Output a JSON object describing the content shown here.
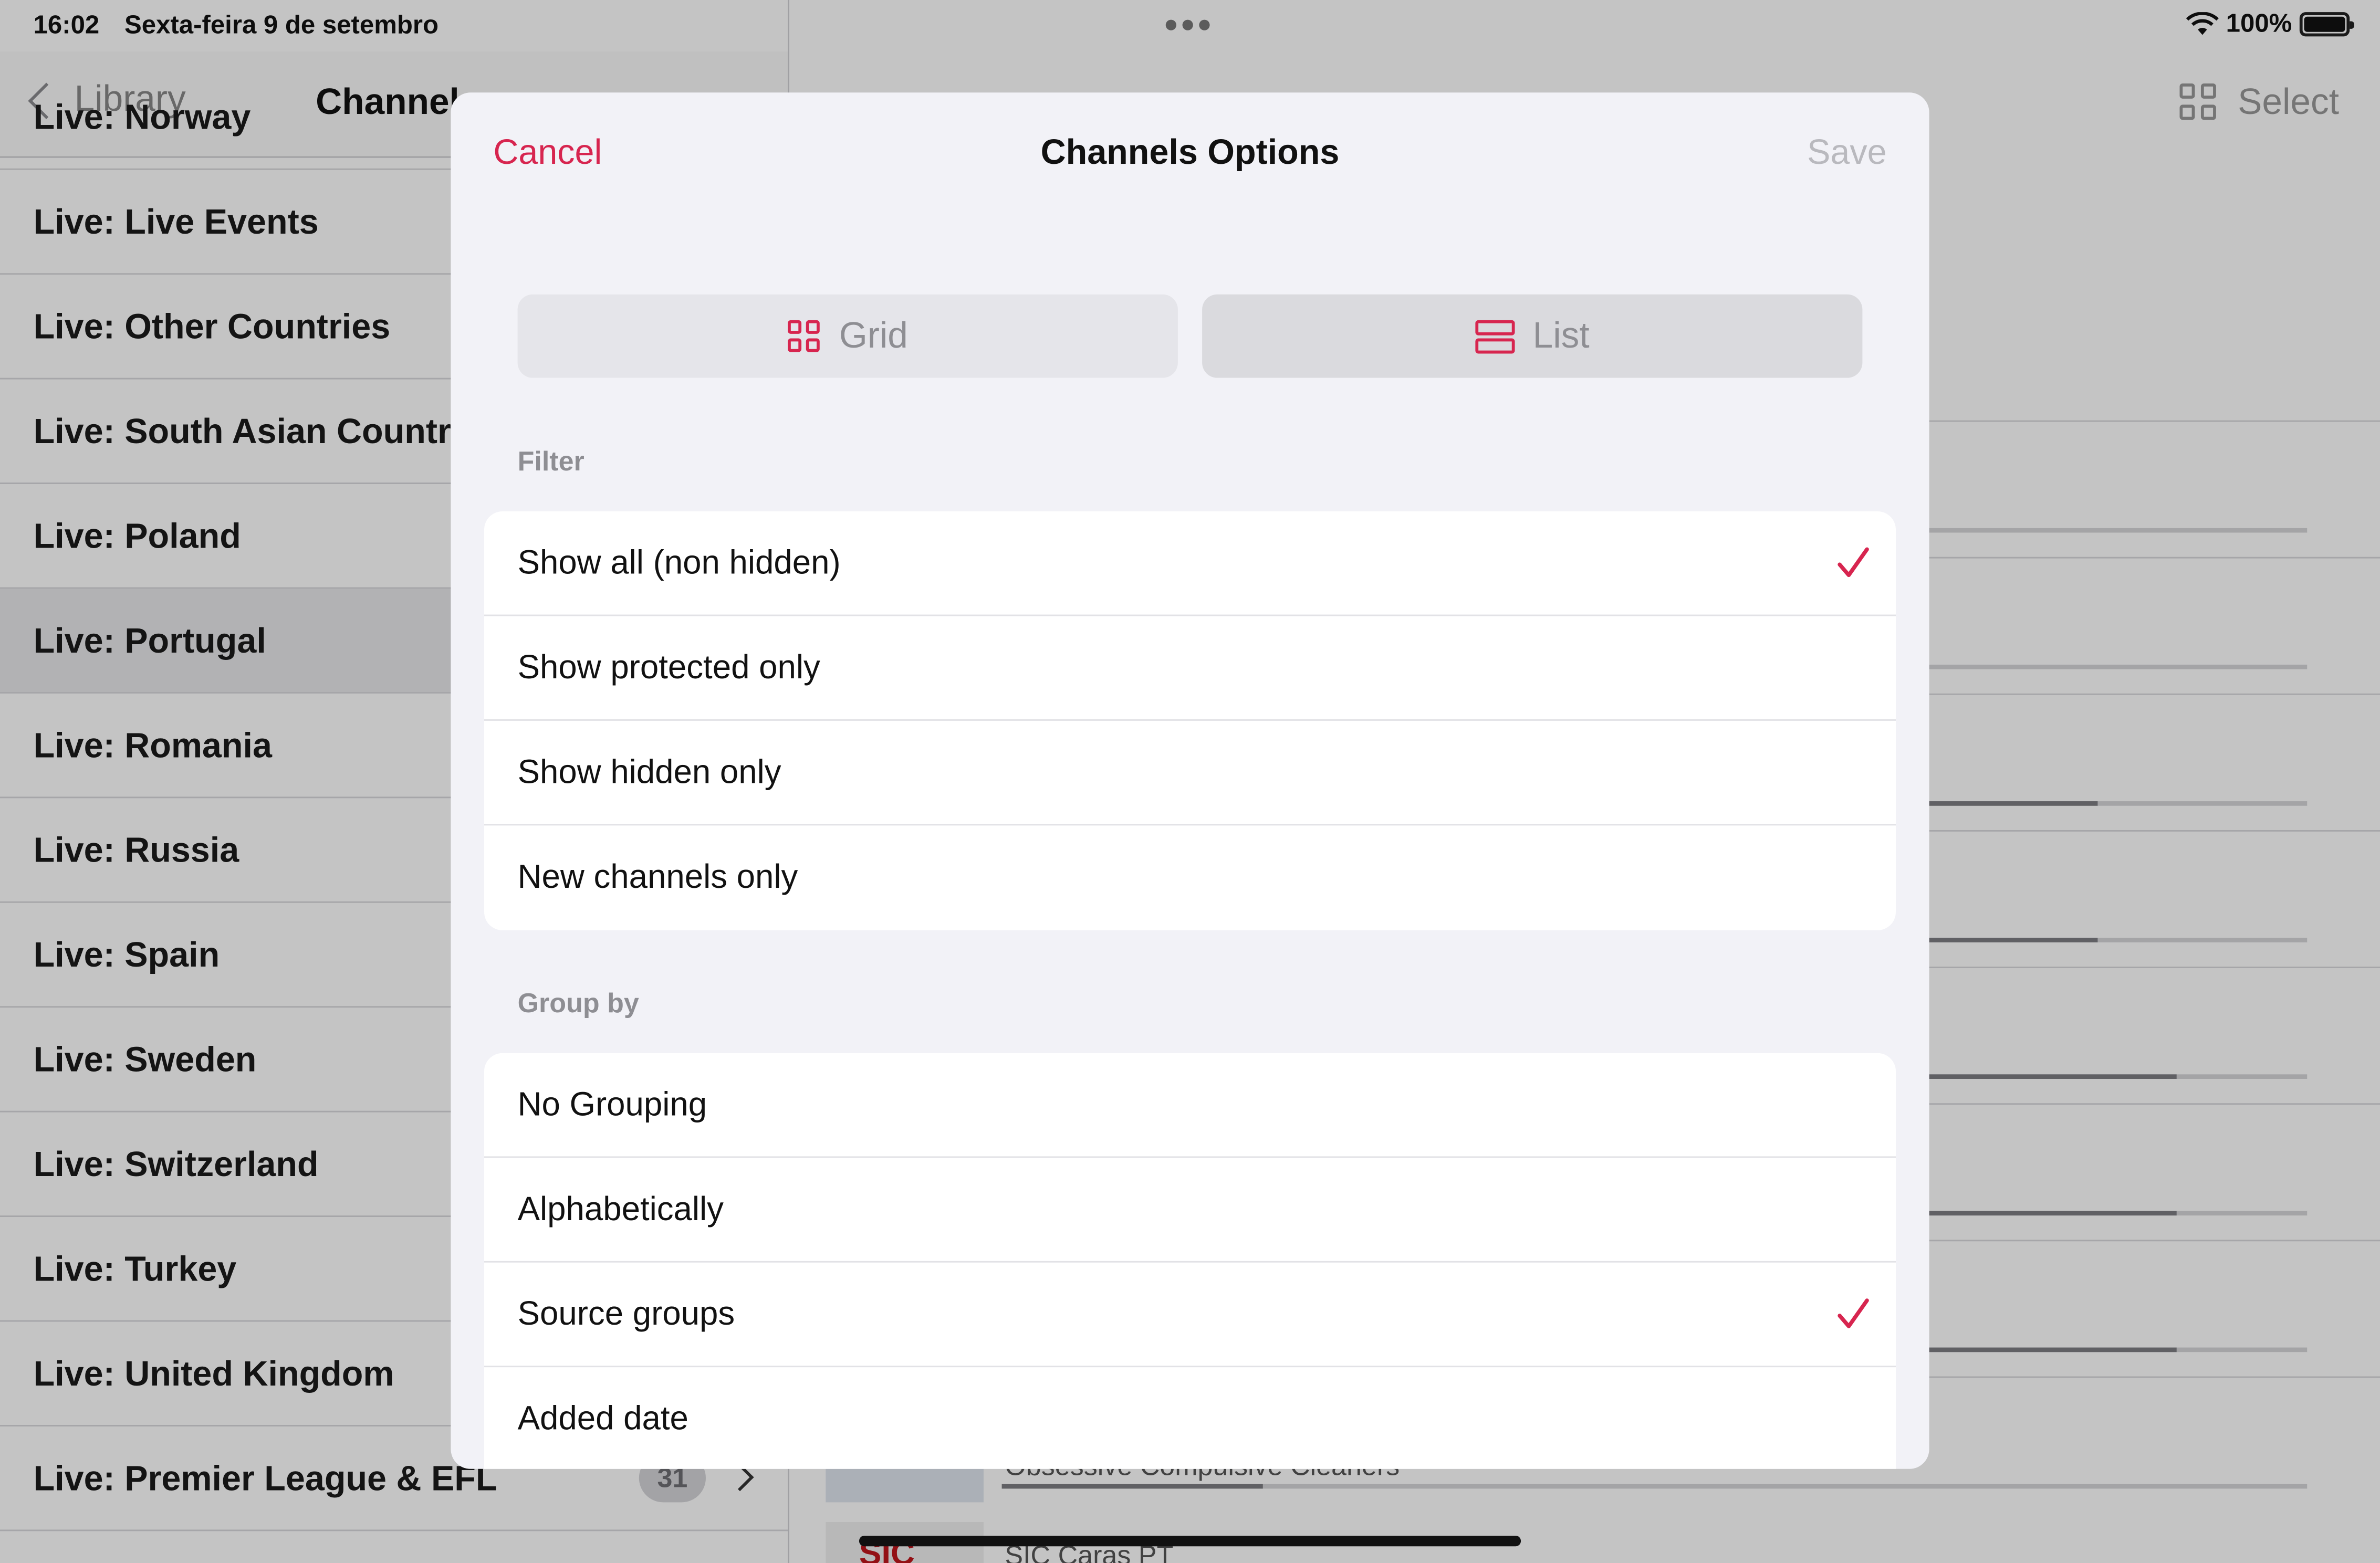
{
  "status_bar": {
    "time": "16:02",
    "date": "Sexta-feira 9 de setembro",
    "battery": "100%"
  },
  "sidebar": {
    "back_label": "Library",
    "title": "Channel",
    "items": [
      {
        "label": "Live: Norway"
      },
      {
        "label": "Live: Live Events"
      },
      {
        "label": "Live: Other Countries"
      },
      {
        "label": "Live: South Asian Countri"
      },
      {
        "label": "Live: Poland"
      },
      {
        "label": "Live: Portugal"
      },
      {
        "label": "Live: Romania"
      },
      {
        "label": "Live: Russia"
      },
      {
        "label": "Live: Spain"
      },
      {
        "label": "Live: Sweden"
      },
      {
        "label": "Live: Switzerland"
      },
      {
        "label": "Live: Turkey"
      },
      {
        "label": "Live: United Kingdom"
      },
      {
        "label": "Live: Premier League & EFL",
        "count": "31"
      }
    ]
  },
  "content": {
    "select_label": "Select",
    "visible_rows": [
      {
        "text": "Obsessive Compulsive Cleaners"
      },
      {
        "text": "SIC Caras PT",
        "logo": "SIC"
      }
    ],
    "progress": [
      0.0,
      0.0,
      0.84,
      0.84,
      0.9,
      0.9,
      0.9,
      0.2
    ]
  },
  "modal": {
    "cancel": "Cancel",
    "title": "Channels Options",
    "save": "Save",
    "layout_options": {
      "grid": "Grid",
      "list": "List",
      "selected": "List"
    },
    "filter": {
      "label": "Filter",
      "options": [
        {
          "label": "Show all (non hidden)",
          "checked": true
        },
        {
          "label": "Show protected only",
          "checked": false
        },
        {
          "label": "Show hidden only",
          "checked": false
        },
        {
          "label": "New channels only",
          "checked": false
        }
      ]
    },
    "group_by": {
      "label": "Group by",
      "options": [
        {
          "label": "No Grouping",
          "checked": false
        },
        {
          "label": "Alphabetically",
          "checked": false
        },
        {
          "label": "Source groups",
          "checked": true
        },
        {
          "label": "Added date",
          "checked": false
        }
      ]
    }
  },
  "colors": {
    "accent": "#d7254f",
    "disabled": "#b9b9be",
    "secondary_text": "#8e8e93"
  }
}
